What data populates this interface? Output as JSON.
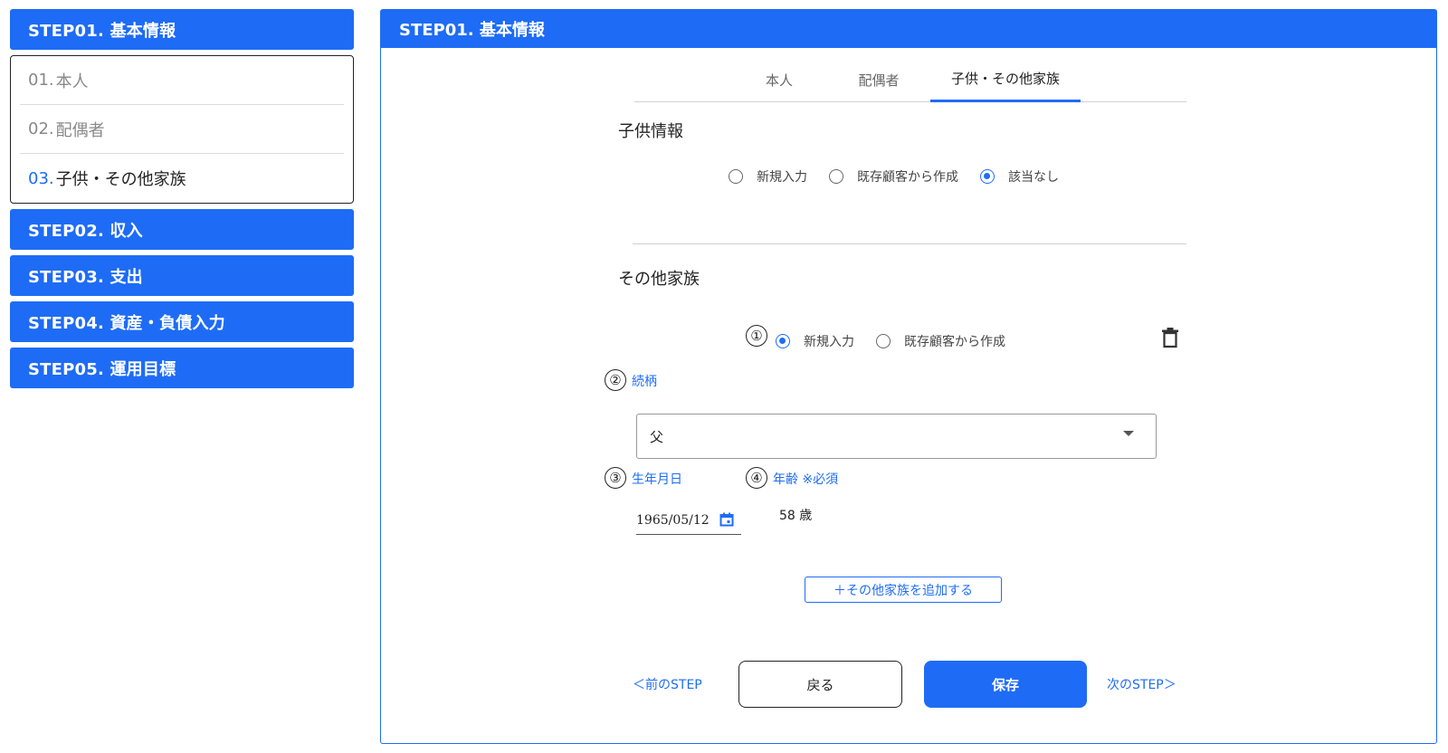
{
  "sidebar": {
    "step01": "STEP01. 基本情報",
    "substeps": [
      {
        "num": "01.",
        "label": "本人"
      },
      {
        "num": "02.",
        "label": "配偶者"
      },
      {
        "num": "03.",
        "label": "子供・その他家族"
      }
    ],
    "step02": "STEP02. 収入",
    "step03": "STEP03. 支出",
    "step04": "STEP04. 資産・負債入力",
    "step05": "STEP05. 運用目標"
  },
  "panel": {
    "title": "STEP01. 基本情報",
    "tabs": [
      {
        "label": "本人"
      },
      {
        "label": "配偶者"
      },
      {
        "label": "子供・その他家族"
      }
    ],
    "children": {
      "title": "子供情報",
      "options": [
        {
          "label": "新規入力",
          "checked": false
        },
        {
          "label": "既存顧客から作成",
          "checked": false
        },
        {
          "label": "該当なし",
          "checked": true
        }
      ]
    },
    "other_family": {
      "title": "その他家族",
      "markers": [
        "①",
        "②",
        "③",
        "④"
      ],
      "options": [
        {
          "label": "新規入力",
          "checked": true
        },
        {
          "label": "既存顧客から作成",
          "checked": false
        }
      ],
      "relation_label": "続柄",
      "relation_value": "父",
      "birth_label": "生年月日",
      "birth_value": "1965/05/12",
      "age_label": "年齢 ※必須",
      "age_value": "58 歳",
      "add_button": "＋その他家族を追加する"
    },
    "nav": {
      "prev_link": "＜前のSTEP",
      "back_button": "戻る",
      "save_button": "保存",
      "next_link": "次のSTEP＞"
    }
  },
  "colors": {
    "accent": "#1e6cf5"
  }
}
